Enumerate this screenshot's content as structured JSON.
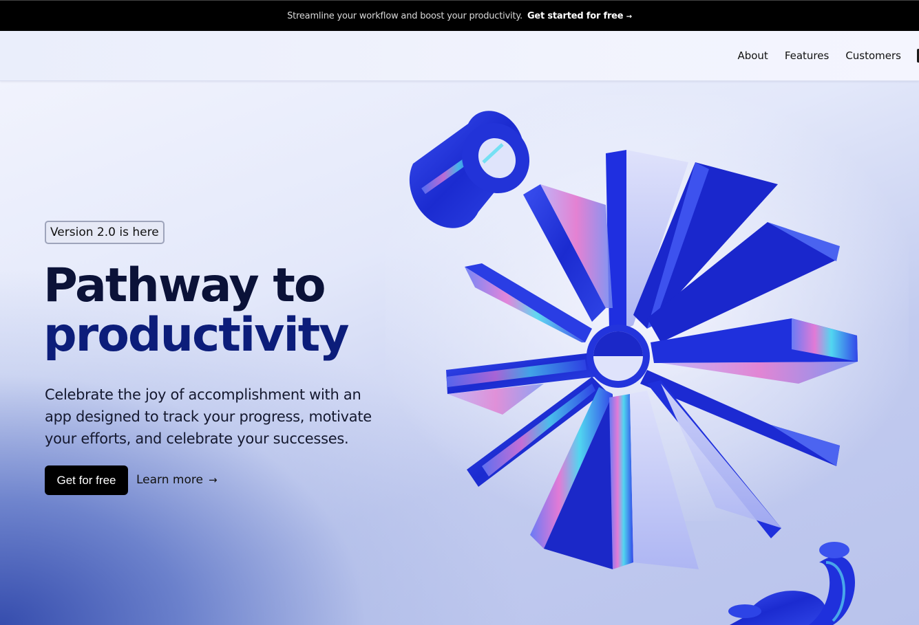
{
  "announcement": {
    "text": "Streamline your workflow and boost your productivity.",
    "cta": "Get started for free",
    "cta_arrow": "→"
  },
  "nav": {
    "links": [
      "About",
      "Features",
      "Customers"
    ]
  },
  "hero": {
    "badge": "Version 2.0 is here",
    "title_line1": "Pathway to",
    "title_line2": "productivity",
    "subtitle": "Celebrate the joy of accomplishment with an app designed to track your progress, motivate your efforts, and celebrate your successes.",
    "primary_button": "Get for free",
    "secondary_link": "Learn more",
    "secondary_arrow": "→"
  },
  "colors": {
    "accent_blue": "#1e2fd6",
    "title_dark": "#0b1238",
    "title_blue": "#0c1d7a"
  },
  "icons": [
    "arrow-right-icon",
    "hero-3d-starburst-illustration"
  ]
}
